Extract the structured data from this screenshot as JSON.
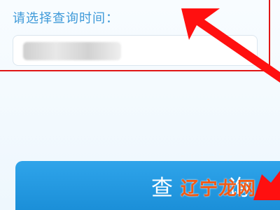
{
  "form": {
    "time_label": "请选择查询时间：",
    "time_value": "2018-01-01"
  },
  "actions": {
    "query_button": "查 询"
  },
  "watermark": {
    "text": "辽宁龙网"
  },
  "annotations": {
    "highlight_color": "#e01515",
    "arrow_color": "#ff1010"
  }
}
